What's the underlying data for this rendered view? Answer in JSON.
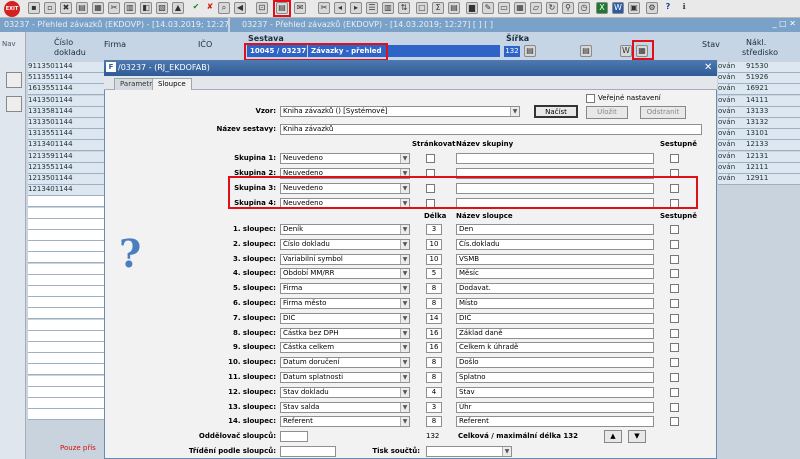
{
  "toolbar": {
    "exit_label": "EXIT"
  },
  "bg": {
    "win1_title": "03237 - Přehled závazků (EKDOVP) - [14.03.2019; 12:27]",
    "win2_title": "03237 - Přehled závazků (EKDOVP) - [14.03.2019; 12:27]  [ ]  [ ]",
    "nav_label": "Nav",
    "col_cislo": "Číslo",
    "col_dokladu": "dokladu",
    "col_firma": "Firma",
    "col_ico": "IČO",
    "sestava_label": "Sestava",
    "sestava_code": "10045 / 03237",
    "sestava_name": "Závazky - přehled",
    "sirka_label": "Šířka",
    "sirka_value": "132",
    "col_stav": "Stav",
    "col_naklady": "Nákl.",
    "col_stredisko": "středisko",
    "rows_left": [
      "9113501144",
      "5113551144",
      "1613551144",
      "1413501144",
      "1313581144",
      "1313501144",
      "1313551144",
      "1313401144",
      "1213591144",
      "1213551144",
      "1213501144",
      "1213401144"
    ],
    "rows_stav": [
      "ován",
      "ován",
      "ován",
      "ován",
      "ován",
      "ován",
      "ován",
      "ován",
      "ován",
      "ován",
      "ován"
    ],
    "rows_str": [
      "91530",
      "51926",
      "16921",
      "14111",
      "13133",
      "13132",
      "13101",
      "12133",
      "12131",
      "12111",
      "12911"
    ],
    "bottom_warning": "Pouze přís"
  },
  "dialog": {
    "title": "/03237 - (RJ_EKDOFAB)",
    "tabs": [
      "Parametry",
      "Sloupce"
    ],
    "vzor_label": "Vzor:",
    "vzor_value": "Kniha závazků   ()   [Systémové]",
    "nacist": "Načíst",
    "verejne": "Veřejné nastavení",
    "ulozit": "Uložit",
    "odstranit": "Odstranit",
    "nazev_sestavy_label": "Název sestavy:",
    "nazev_sestavy_value": "Kniha závazků",
    "h_strankovat": "Stránkovat",
    "h_nazev_skupiny": "Název skupiny",
    "h_sestupne": "Sestupně",
    "skupiny": [
      {
        "label": "Skupina 1:",
        "value": "Neuvedeno"
      },
      {
        "label": "Skupina 2:",
        "value": "Neuvedeno"
      },
      {
        "label": "Skupina 3:",
        "value": "Neuvedeno"
      },
      {
        "label": "Skupina 4:",
        "value": "Neuvedeno"
      }
    ],
    "h_delka": "Délka",
    "h_nazev_sloupce": "Název sloupce",
    "h_sestupne2": "Sestupně",
    "sloupce": [
      {
        "label": "1. sloupec:",
        "value": "Deník",
        "len": "3",
        "name": "Den"
      },
      {
        "label": "2. sloupec:",
        "value": "Číslo dokladu",
        "len": "10",
        "name": "Čís.dokladu"
      },
      {
        "label": "3. sloupec:",
        "value": "Variabilní symbol",
        "len": "10",
        "name": "VSMB"
      },
      {
        "label": "4. sloupec:",
        "value": "Období MM/RR",
        "len": "5",
        "name": "Měsíc"
      },
      {
        "label": "5. sloupec:",
        "value": "Firma",
        "len": "8",
        "name": "Dodavat."
      },
      {
        "label": "6. sloupec:",
        "value": "Firma město",
        "len": "8",
        "name": "Místo"
      },
      {
        "label": "7. sloupec:",
        "value": "DIČ",
        "len": "14",
        "name": "DIČ"
      },
      {
        "label": "8. sloupec:",
        "value": "Částka bez DPH",
        "len": "16",
        "name": "Základ daně"
      },
      {
        "label": "9. sloupec:",
        "value": "Částka celkem",
        "len": "16",
        "name": "Celkem k úhradě"
      },
      {
        "label": "10. sloupec:",
        "value": "Datum doručení",
        "len": "8",
        "name": "Došlo"
      },
      {
        "label": "11. sloupec:",
        "value": "Datum splatnosti",
        "len": "8",
        "name": "Splatno"
      },
      {
        "label": "12. sloupec:",
        "value": "Stav dokladu",
        "len": "4",
        "name": "Stav"
      },
      {
        "label": "13. sloupec:",
        "value": "Stav salda",
        "len": "3",
        "name": "Úhr"
      },
      {
        "label": "14. sloupec:",
        "value": "Referent",
        "len": "8",
        "name": "Referent"
      }
    ],
    "oddelovac_label": "Oddělovač sloupců:",
    "total_len": "132",
    "total_text": "Celková / maximální délka 132",
    "trideni_label": "Třídění podle sloupců:",
    "tisk_label": "Tisk součtů:"
  },
  "colors": {
    "highlight": "#e0101a",
    "title_blue": "#2e5a96"
  }
}
